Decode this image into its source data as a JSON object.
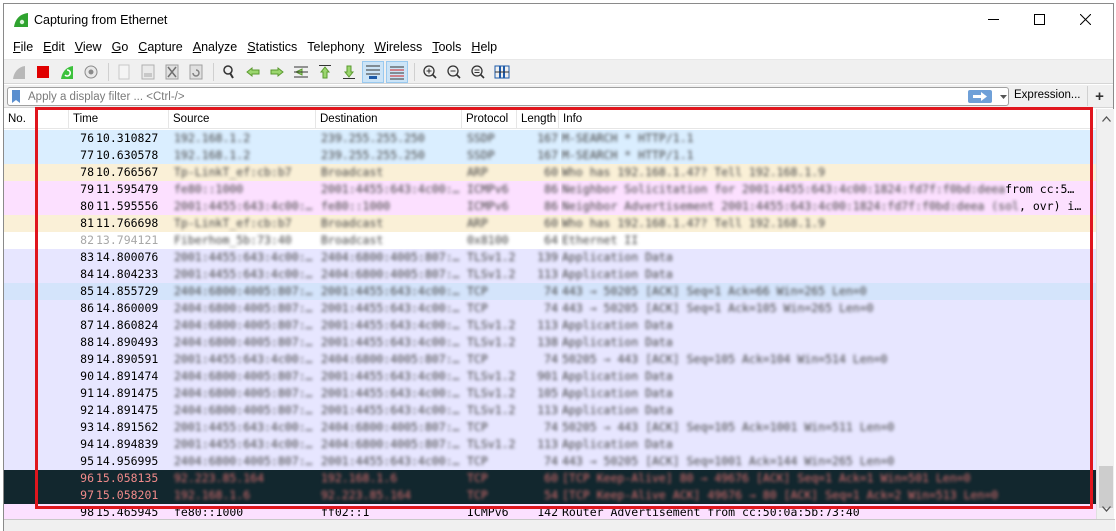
{
  "window": {
    "title": "Capturing from Ethernet",
    "controls": {
      "minimize": "minimize",
      "maximize": "maximize",
      "close": "close"
    }
  },
  "menu": [
    {
      "label": "File",
      "mnemonic": "F",
      "rest": "ile"
    },
    {
      "label": "Edit",
      "mnemonic": "E",
      "rest": "dit"
    },
    {
      "label": "View",
      "mnemonic": "V",
      "rest": "iew"
    },
    {
      "label": "Go",
      "mnemonic": "G",
      "rest": "o"
    },
    {
      "label": "Capture",
      "mnemonic": "C",
      "rest": "apture"
    },
    {
      "label": "Analyze",
      "mnemonic": "A",
      "rest": "nalyze"
    },
    {
      "label": "Statistics",
      "mnemonic": "S",
      "rest": "tatistics"
    },
    {
      "label": "Telephony",
      "prefix": "Telephon",
      "mnemonic": "y"
    },
    {
      "label": "Wireless",
      "mnemonic": "W",
      "rest": "ireless"
    },
    {
      "label": "Tools",
      "mnemonic": "T",
      "rest": "ools"
    },
    {
      "label": "Help",
      "mnemonic": "H",
      "rest": "elp"
    }
  ],
  "toolbar": {
    "buttons": [
      {
        "icon": "start-capture-icon",
        "enabled": false
      },
      {
        "icon": "stop-capture-icon",
        "enabled": true
      },
      {
        "icon": "restart-capture-icon",
        "enabled": true
      },
      {
        "icon": "capture-options-icon",
        "enabled": true
      },
      {
        "icon": "open-file-icon",
        "enabled": false
      },
      {
        "icon": "save-file-icon",
        "enabled": false
      },
      {
        "icon": "close-file-icon",
        "enabled": false
      },
      {
        "icon": "reload-file-icon",
        "enabled": false
      },
      {
        "icon": "find-packet-icon",
        "enabled": true
      },
      {
        "icon": "go-back-icon",
        "enabled": true
      },
      {
        "icon": "go-forward-icon",
        "enabled": true
      },
      {
        "icon": "go-to-packet-icon",
        "enabled": true
      },
      {
        "icon": "go-first-packet-icon",
        "enabled": true
      },
      {
        "icon": "go-last-packet-icon",
        "enabled": true
      },
      {
        "icon": "auto-scroll-icon",
        "enabled": true,
        "active": true
      },
      {
        "icon": "colorize-icon",
        "enabled": true,
        "active": true
      },
      {
        "icon": "zoom-in-icon",
        "enabled": true
      },
      {
        "icon": "zoom-out-icon",
        "enabled": true
      },
      {
        "icon": "zoom-reset-icon",
        "enabled": true
      },
      {
        "icon": "resize-columns-icon",
        "enabled": true
      }
    ]
  },
  "filter": {
    "placeholder": "Apply a display filter ... <Ctrl-/>",
    "value": "",
    "expression_label": "Expression...",
    "add_label": "+"
  },
  "packet_list": {
    "columns": [
      "No.",
      "Time",
      "Source",
      "Destination",
      "Protocol",
      "Length",
      "Info"
    ],
    "rows": [
      {
        "no": "76",
        "time": "10.310827",
        "source": "192.168.1.2",
        "destination": "239.255.255.250",
        "protocol": "SSDP",
        "length": "167",
        "info": "M-SEARCH * HTTP/1.1",
        "bg": "#daeeff",
        "style": "normal"
      },
      {
        "no": "77",
        "time": "10.630578",
        "source": "192.168.1.2",
        "destination": "239.255.255.250",
        "protocol": "SSDP",
        "length": "167",
        "info": "M-SEARCH * HTTP/1.1",
        "bg": "#daeeff",
        "style": "normal"
      },
      {
        "no": "78",
        "time": "10.766567",
        "source": "Tp-LinkT_ef:cb:b7",
        "destination": "Broadcast",
        "protocol": "ARP",
        "length": "60",
        "info": "Who has 192.168.1.47? Tell 192.168.1.9",
        "bg": "#faf0d7",
        "style": "normal"
      },
      {
        "no": "79",
        "time": "11.595479",
        "source": "fe80::1000",
        "destination": "2001:4455:643:4c00:…",
        "protocol": "ICMPv6",
        "length": "86",
        "info": "Neighbor Solicitation for 2001:4455:643:4c00:1824:fd7f:f0bd:deea",
        "info_tail": "from cc:5…",
        "bg": "#fce0ff",
        "style": "normal"
      },
      {
        "no": "80",
        "time": "11.595556",
        "source": "2001:4455:643:4c00:…",
        "destination": "fe80::1000",
        "protocol": "ICMPv6",
        "length": "86",
        "info": "Neighbor Advertisement 2001:4455:643:4c00:1824:fd7f:f0bd:deea (sol",
        "info_tail": ", ovr) i…",
        "bg": "#fce0ff",
        "style": "normal"
      },
      {
        "no": "81",
        "time": "11.766698",
        "source": "Tp-LinkT_ef:cb:b7",
        "destination": "Broadcast",
        "protocol": "ARP",
        "length": "60",
        "info": "Who has 192.168.1.47? Tell 192.168.1.9",
        "bg": "#faf0d7",
        "style": "normal"
      },
      {
        "no": "82",
        "time": "13.794121",
        "source": "Fiberhom_5b:73:40",
        "destination": "Broadcast",
        "protocol": "0x8100",
        "length": "64",
        "info": "Ethernet II",
        "bg": "#ffffff",
        "style": "dim"
      },
      {
        "no": "83",
        "time": "14.800076",
        "source": "2001:4455:643:4c00:…",
        "destination": "2404:6800:4005:807:…",
        "protocol": "TLSv1.2",
        "length": "139",
        "info": "Application Data",
        "bg": "#e7e6ff",
        "style": "normal"
      },
      {
        "no": "84",
        "time": "14.804233",
        "source": "2001:4455:643:4c00:…",
        "destination": "2404:6800:4005:807:…",
        "protocol": "TLSv1.2",
        "length": "113",
        "info": "Application Data",
        "bg": "#e7e6ff",
        "style": "normal"
      },
      {
        "no": "85",
        "time": "14.855729",
        "source": "2404:6800:4005:807:…",
        "destination": "2001:4455:643:4c00:…",
        "protocol": "TCP",
        "length": "74",
        "info": "443 → 50205 [ACK] Seq=1 Ack=66 Win=265 Len=0",
        "bg": "#d4e4fb",
        "style": "normal"
      },
      {
        "no": "86",
        "time": "14.860009",
        "source": "2404:6800:4005:807:…",
        "destination": "2001:4455:643:4c00:…",
        "protocol": "TCP",
        "length": "74",
        "info": "443 → 50205 [ACK] Seq=1 Ack=105 Win=265 Len=0",
        "bg": "#e7e6ff",
        "style": "normal"
      },
      {
        "no": "87",
        "time": "14.860824",
        "source": "2404:6800:4005:807:…",
        "destination": "2001:4455:643:4c00:…",
        "protocol": "TLSv1.2",
        "length": "113",
        "info": "Application Data",
        "bg": "#e7e6ff",
        "style": "normal"
      },
      {
        "no": "88",
        "time": "14.890493",
        "source": "2404:6800:4005:807:…",
        "destination": "2001:4455:643:4c00:…",
        "protocol": "TLSv1.2",
        "length": "138",
        "info": "Application Data",
        "bg": "#e7e6ff",
        "style": "normal"
      },
      {
        "no": "89",
        "time": "14.890591",
        "source": "2001:4455:643:4c00:…",
        "destination": "2404:6800:4005:807:…",
        "protocol": "TCP",
        "length": "74",
        "info": "50205 → 443 [ACK] Seq=105 Ack=104 Win=514 Len=0",
        "bg": "#e7e6ff",
        "style": "normal"
      },
      {
        "no": "90",
        "time": "14.891474",
        "source": "2404:6800:4005:807:…",
        "destination": "2001:4455:643:4c00:…",
        "protocol": "TLSv1.2",
        "length": "901",
        "info": "Application Data",
        "bg": "#e7e6ff",
        "style": "normal"
      },
      {
        "no": "91",
        "time": "14.891475",
        "source": "2404:6800:4005:807:…",
        "destination": "2001:4455:643:4c00:…",
        "protocol": "TLSv1.2",
        "length": "105",
        "info": "Application Data",
        "bg": "#e7e6ff",
        "style": "normal"
      },
      {
        "no": "92",
        "time": "14.891475",
        "source": "2404:6800:4005:807:…",
        "destination": "2001:4455:643:4c00:…",
        "protocol": "TLSv1.2",
        "length": "113",
        "info": "Application Data",
        "bg": "#e7e6ff",
        "style": "normal"
      },
      {
        "no": "93",
        "time": "14.891562",
        "source": "2001:4455:643:4c00:…",
        "destination": "2404:6800:4005:807:…",
        "protocol": "TCP",
        "length": "74",
        "info": "50205 → 443 [ACK] Seq=105 Ack=1001 Win=511 Len=0",
        "bg": "#e7e6ff",
        "style": "normal"
      },
      {
        "no": "94",
        "time": "14.894839",
        "source": "2001:4455:643:4c00:…",
        "destination": "2404:6800:4005:807:…",
        "protocol": "TLSv1.2",
        "length": "113",
        "info": "Application Data",
        "bg": "#e7e6ff",
        "style": "normal"
      },
      {
        "no": "95",
        "time": "14.956995",
        "source": "2404:6800:4005:807:…",
        "destination": "2001:4455:643:4c00:…",
        "protocol": "TCP",
        "length": "74",
        "info": "443 → 50205 [ACK] Seq=1001 Ack=144 Win=265 Len=0",
        "bg": "#e7e6ff",
        "style": "normal"
      },
      {
        "no": "96",
        "time": "15.058135",
        "source": "92.223.85.164",
        "destination": "192.168.1.6",
        "protocol": "TCP",
        "length": "60",
        "info": "[TCP Keep-Alive] 80 → 49676 [ACK] Seq=1 Ack=1 Win=501 Len=0",
        "bg": "#12272e",
        "style": "dark"
      },
      {
        "no": "97",
        "time": "15.058201",
        "source": "192.168.1.6",
        "destination": "92.223.85.164",
        "protocol": "TCP",
        "length": "54",
        "info": "[TCP Keep-Alive ACK] 49676 → 80 [ACK] Seq=1 Ack=2 Win=513 Len=0",
        "bg": "#12272e",
        "style": "dark"
      },
      {
        "no": "98",
        "time": "15.465945",
        "source": "fe80::1000",
        "destination": "ff02::1",
        "protocol": "ICMPv6",
        "length": "142",
        "info": "Router Advertisement from cc:50:0a:5b:73:40",
        "bg": "#fce0ff",
        "style": "clear"
      }
    ]
  },
  "colors": {
    "annotation": "#e0161e",
    "selected_row": "#d4e4fb",
    "dark_row_text": "#f08a8a"
  }
}
